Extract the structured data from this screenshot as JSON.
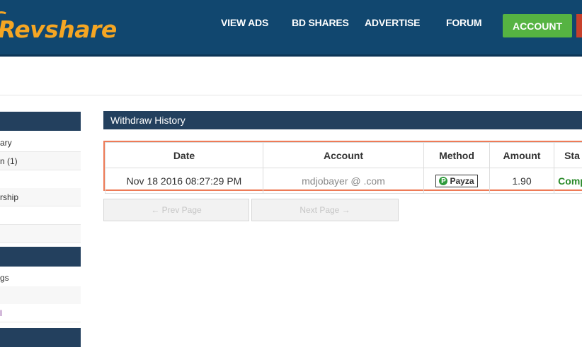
{
  "header": {
    "logo_text": "Revshare",
    "nav": {
      "view_ads": "VIEW ADS",
      "bd_shares": "BD SHARES",
      "advertise": "ADVERTISE",
      "forum": "FORUM"
    },
    "account_button": "ACCOUNT"
  },
  "sidebar": {
    "items": [
      "ary",
      "n (1)",
      "",
      "rship",
      "",
      "",
      "gs",
      "",
      "l"
    ]
  },
  "panel": {
    "title": "Withdraw History",
    "columns": [
      "Date",
      "Account",
      "Method",
      "Amount",
      "Sta"
    ],
    "rows": [
      {
        "date": "Nov 18 2016 08:27:29 PM",
        "account": "mdjobayer   @        .com",
        "method": "Payza",
        "amount": "1.90",
        "status": "Comp"
      }
    ],
    "pager": {
      "prev": "← Prev Page",
      "next": "Next Page →"
    }
  },
  "colors": {
    "header_bg": "#11476f",
    "logo": "#f5a623",
    "account_button": "#56b342",
    "panel_head": "#23405e",
    "table_border": "#ee7b57",
    "status": "#2a8a2a"
  }
}
